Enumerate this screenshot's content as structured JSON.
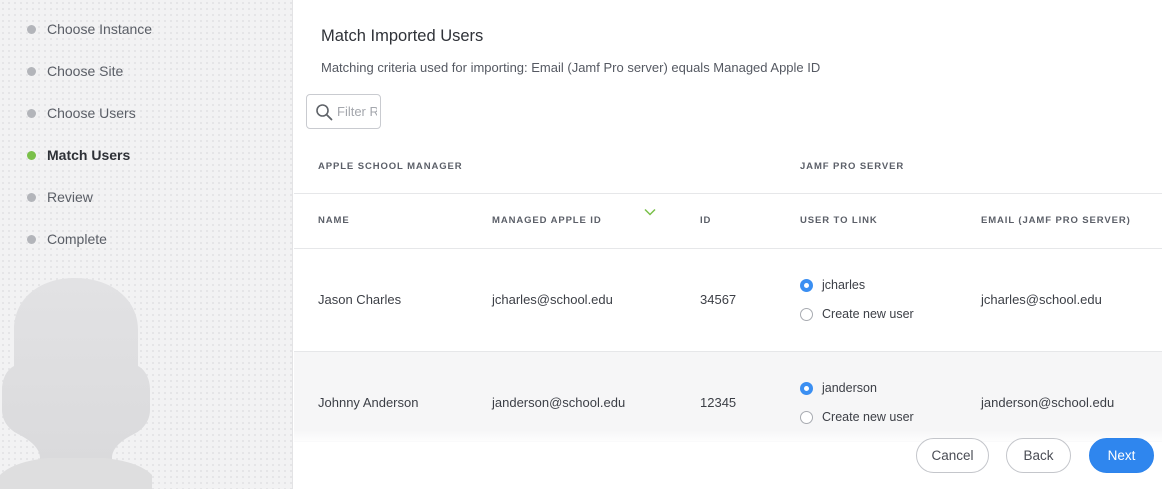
{
  "sidebar": {
    "steps": [
      {
        "label": "Choose Instance",
        "state": "done"
      },
      {
        "label": "Choose Site",
        "state": "done"
      },
      {
        "label": "Choose Users",
        "state": "done"
      },
      {
        "label": "Match Users",
        "state": "active"
      },
      {
        "label": "Review",
        "state": "pending"
      },
      {
        "label": "Complete",
        "state": "pending"
      }
    ],
    "active_color": "#7ac04a"
  },
  "main": {
    "title": "Match Imported Users",
    "criteria": "Matching criteria used for importing: Email (Jamf Pro server) equals Managed Apple ID",
    "filter": {
      "placeholder": "Filter Results",
      "value": ""
    },
    "groups": {
      "asm": "APPLE SCHOOL MANAGER",
      "jamf": "JAMF PRO SERVER"
    },
    "columns": {
      "name": "NAME",
      "managed_apple_id": "MANAGED APPLE ID",
      "id": "ID",
      "user_to_link": "USER TO LINK",
      "email": "EMAIL (JAMF PRO SERVER)"
    },
    "rows": [
      {
        "name": "Jason Charles",
        "managed_apple_id": "jcharles@school.edu",
        "id": "34567",
        "link_options": [
          "jcharles",
          "Create new user"
        ],
        "selected": 0,
        "email": "jcharles@school.edu"
      },
      {
        "name": "Johnny Anderson",
        "managed_apple_id": "janderson@school.edu",
        "id": "12345",
        "link_options": [
          "janderson",
          "Create new user"
        ],
        "selected": 0,
        "email": "janderson@school.edu"
      }
    ]
  },
  "footer": {
    "cancel": "Cancel",
    "back": "Back",
    "next": "Next"
  },
  "colors": {
    "primary": "#2f86ee",
    "radio_selected": "#3b8ff2",
    "sort_icon": "#7ac04a"
  }
}
